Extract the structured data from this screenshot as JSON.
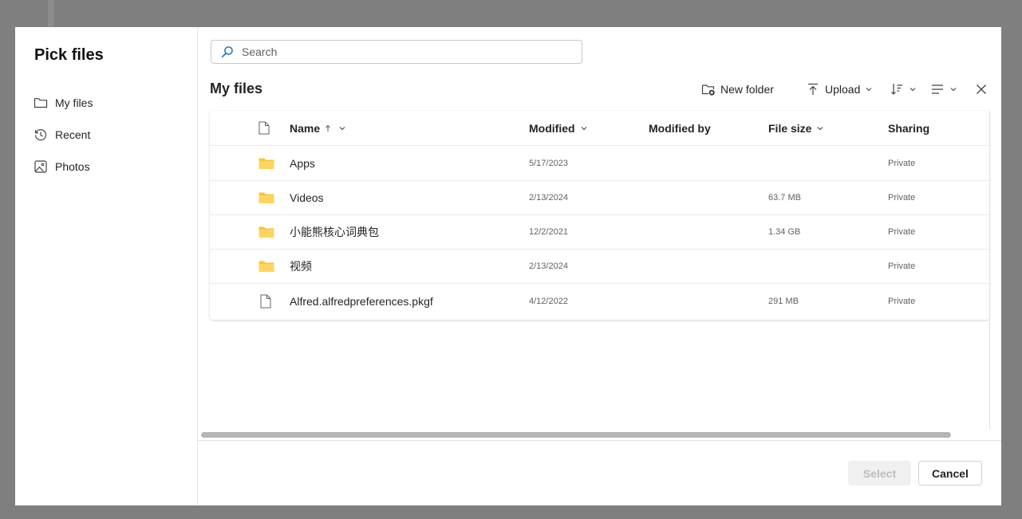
{
  "dialog": {
    "title": "Pick files"
  },
  "sidebar": {
    "items": [
      {
        "label": "My files",
        "icon": "folder-icon"
      },
      {
        "label": "Recent",
        "icon": "history-icon"
      },
      {
        "label": "Photos",
        "icon": "image-icon"
      }
    ]
  },
  "search": {
    "placeholder": "Search",
    "value": ""
  },
  "main": {
    "title": "My files"
  },
  "toolbar": {
    "new_folder": "New folder",
    "upload": "Upload"
  },
  "table": {
    "columns": {
      "name": "Name",
      "modified": "Modified",
      "modified_by": "Modified by",
      "file_size": "File size",
      "sharing": "Sharing"
    },
    "rows": [
      {
        "type": "folder",
        "name": "Apps",
        "modified": "5/17/2023",
        "modified_by": "",
        "size": "",
        "sharing": "Private"
      },
      {
        "type": "folder",
        "name": "Videos",
        "modified": "2/13/2024",
        "modified_by": "",
        "size": "63.7 MB",
        "sharing": "Private"
      },
      {
        "type": "folder",
        "name": "小能熊核心词典包",
        "modified": "12/2/2021",
        "modified_by": "",
        "size": "1.34 GB",
        "sharing": "Private"
      },
      {
        "type": "folder",
        "name": "视频",
        "modified": "2/13/2024",
        "modified_by": "",
        "size": "",
        "sharing": "Private"
      },
      {
        "type": "file",
        "name": "Alfred.alfredpreferences.pkgf",
        "modified": "4/12/2022",
        "modified_by": "",
        "size": "291 MB",
        "sharing": "Private"
      }
    ]
  },
  "footer": {
    "select": "Select",
    "cancel": "Cancel"
  },
  "colors": {
    "folder": "#F5C542",
    "accent": "#0F6CBD",
    "disabled_bg": "#F0F0F0"
  }
}
